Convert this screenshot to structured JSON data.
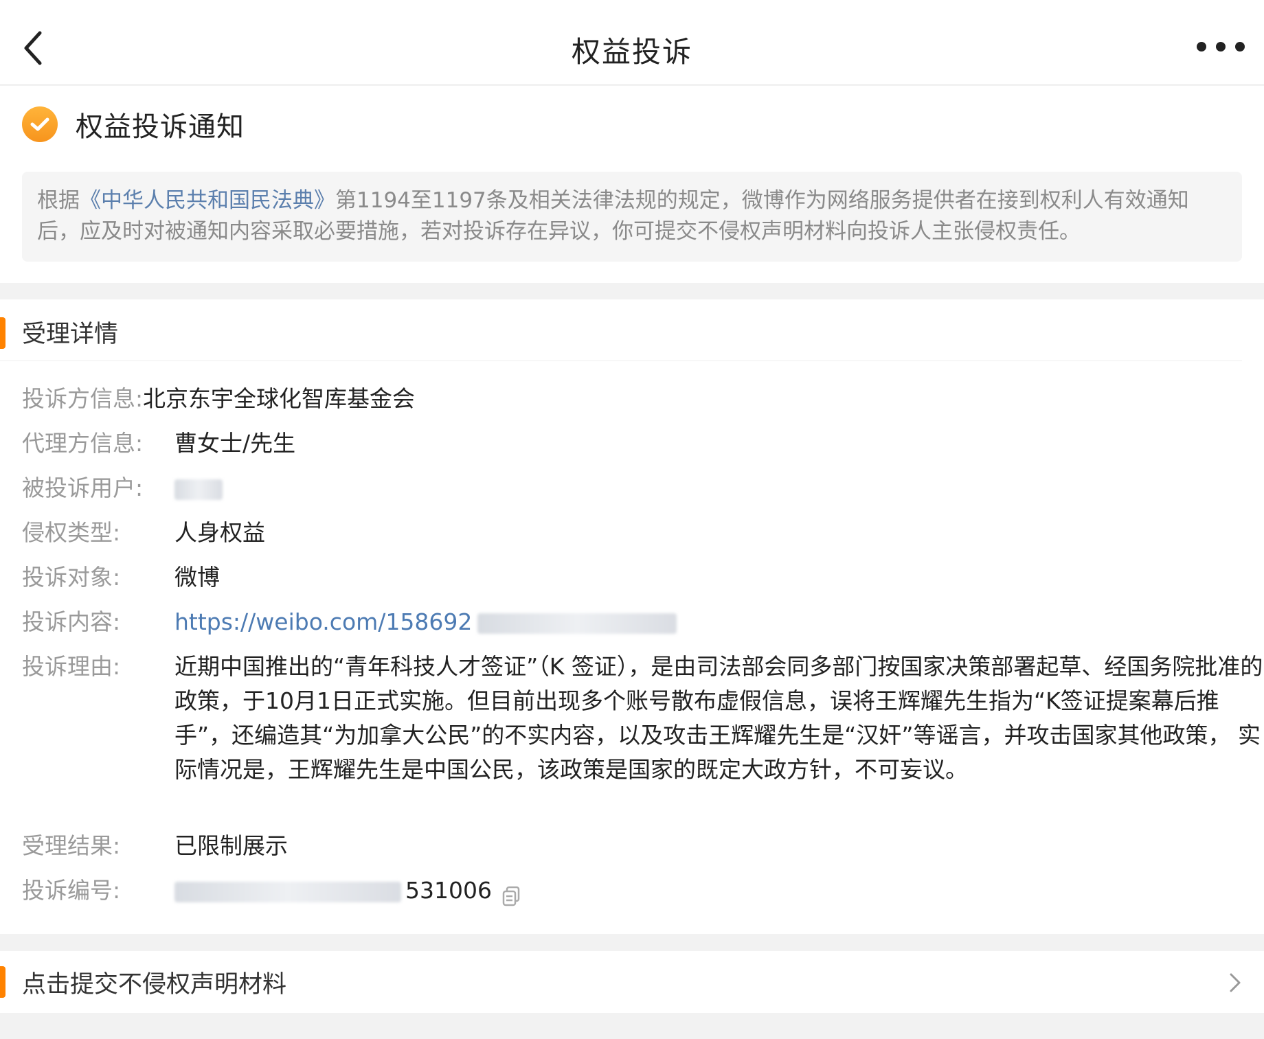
{
  "nav": {
    "title": "权益投诉",
    "back_icon": "back-arrow-icon",
    "more_icon": "more-dots-icon"
  },
  "notice": {
    "icon": "check-circle-icon",
    "icon_color": "#f7941d",
    "title": "权益投诉通知",
    "text_prefix": "根据",
    "law_name": "《中华人民共和国民法典》",
    "text_body": "第1194至1197条及相关法律法规的规定，微博作为网络服务提供者在接到权利人有效通知后，应及时对被通知内容采取必要措施，若对投诉存在异议，你可提交不侵权声明材料向投诉人主张侵权责任。"
  },
  "detail": {
    "section_title": "受理详情",
    "accent_color": "#ff8200",
    "link_color": "#4d7bb3",
    "rows": [
      {
        "label": "投诉方信息:",
        "value": "北京东宇全球化智库基金会"
      },
      {
        "label": "代理方信息:",
        "value": "曹女士/先生"
      },
      {
        "label": "被投诉用户:",
        "value": ""
      },
      {
        "label": "侵权类型:",
        "value": "人身权益"
      },
      {
        "label": "投诉对象:",
        "value": "微博"
      },
      {
        "label": "投诉内容:",
        "value": "https://weibo.com/158692"
      },
      {
        "label": "投诉理由:",
        "value": "近期中国推出的“青年科技人才签证”（K 签证），是由司法部会同多部门按国家决策部署起草、经国务院批准的政策，于10月1日正式实施。但目前出现多个账号散布虚假信息，误将王辉耀先生指为“K签证提案幕后推手”，还编造其“为加拿大公民”的不实内容，以及攻击王辉耀先生是“汉奸”等谣言，并攻击国家其他政策， 实际情况是，王辉耀先生是中国公民，该政策是国家的既定大政方针，不可妄议。"
      },
      {
        "label": "受理结果:",
        "value": "已限制展示"
      },
      {
        "label": "投诉编号:",
        "value": "531006"
      }
    ],
    "copy_icon": "copy-icon"
  },
  "submit": {
    "label": "点击提交不侵权声明材料",
    "chevron_icon": "chevron-right-icon"
  }
}
